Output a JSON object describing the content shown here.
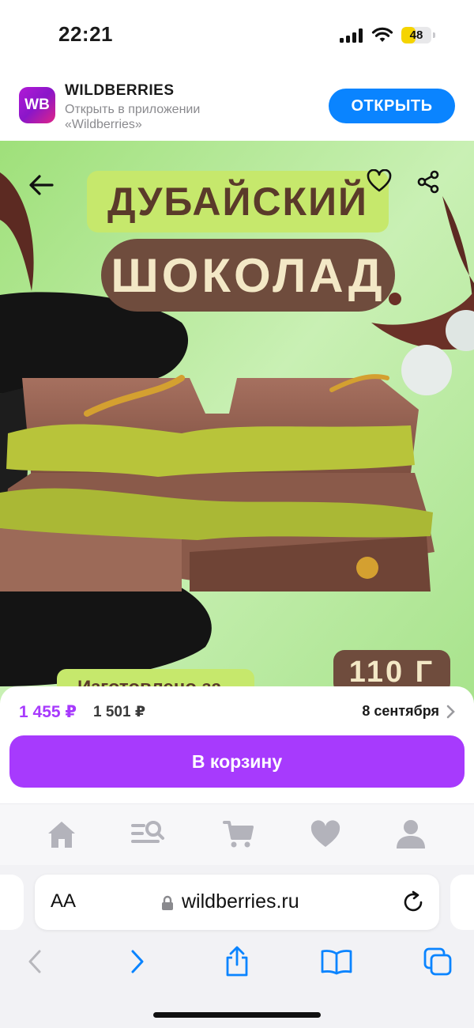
{
  "status_bar": {
    "time": "22:21",
    "battery_level": "48",
    "battery_accent": "#f5d400"
  },
  "app_banner": {
    "logo_text": "WB",
    "title": "WILDBERRIES",
    "subtitle": "Открыть в приложении «Wildberries»",
    "open_label": "ОТКРЫТЬ"
  },
  "product_image": {
    "headline_line1": "ДУБАЙСКИЙ",
    "headline_line2": "ШОКОЛАД",
    "weight": "110 Г",
    "bottom_label": "Изготовлено за",
    "icons": [
      "back-arrow-icon",
      "heart-icon",
      "share-icon"
    ]
  },
  "purchase": {
    "price": "1 455 ₽",
    "old_price": "1 501 ₽",
    "delivery_date": "8 сентября",
    "cart_label": "В корзину",
    "accent_color": "#a73afd"
  },
  "site_nav": {
    "items": [
      "home-icon",
      "catalog-search-icon",
      "cart-icon",
      "favorites-icon",
      "profile-icon"
    ]
  },
  "safari": {
    "text_size_label": "AA",
    "url": "wildberries.ru",
    "toolbar": [
      "back-icon",
      "forward-icon",
      "share-icon",
      "bookmarks-icon",
      "tabs-icon"
    ]
  }
}
